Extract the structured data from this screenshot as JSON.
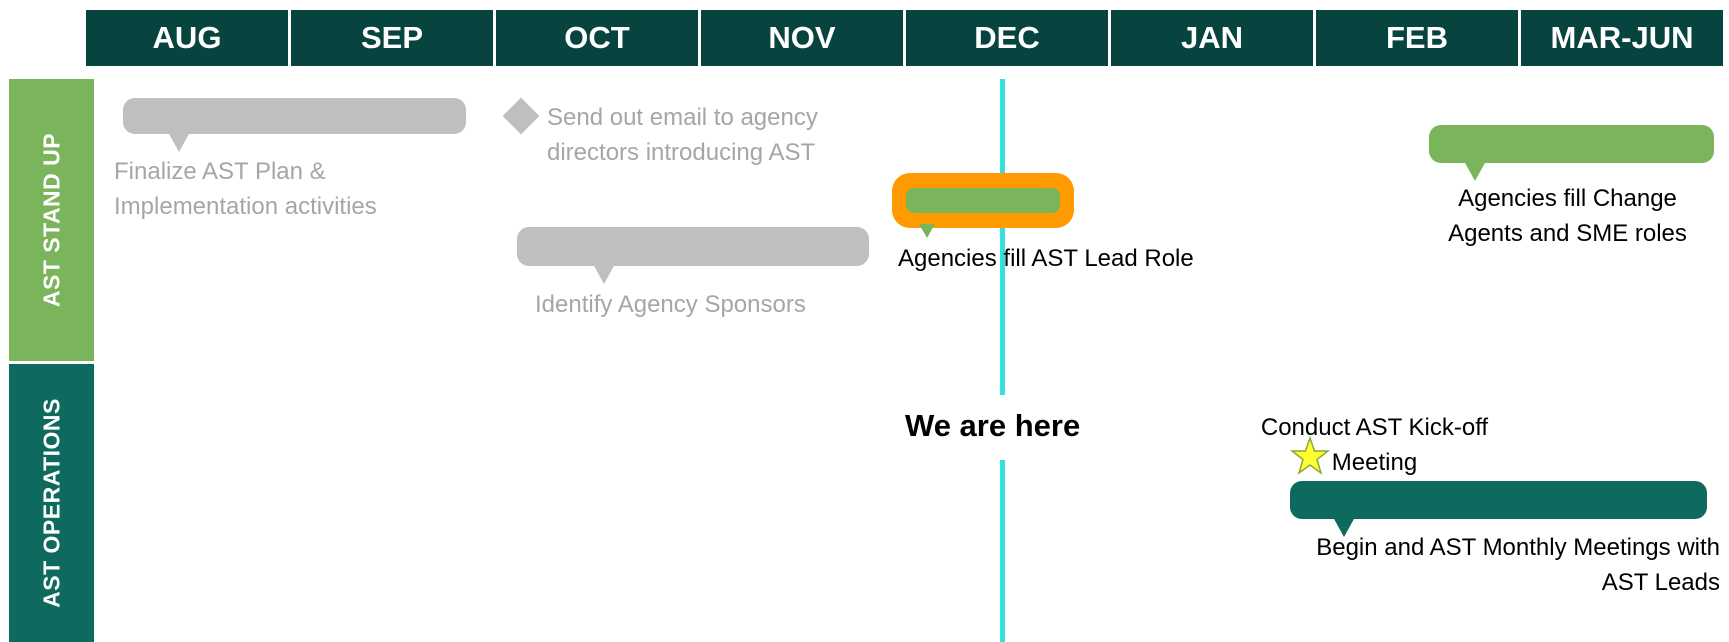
{
  "months": [
    "AUG",
    "SEP",
    "OCT",
    "NOV",
    "DEC",
    "JAN",
    "FEB",
    "MAR-JUN"
  ],
  "rows": {
    "stand_up": "AST STAND UP",
    "operations": "AST OPERATIONS"
  },
  "activities": {
    "finalize_plan": "Finalize AST Plan & Implementation activities",
    "send_email": "Send out email to agency directors introducing AST",
    "identify_sponsors": "Identify Agency Sponsors",
    "fill_lead_role": "Agencies fill AST Lead Role",
    "fill_change_agents": "Agencies fill Change Agents and SME roles",
    "kickoff_meeting": "Conduct AST Kick-off Meeting",
    "monthly_meetings": "Begin and AST Monthly Meetings with AST Leads"
  },
  "marker": {
    "label": "We are here"
  },
  "colors": {
    "header": "#08443f",
    "stand_up_row": "#7ab55c",
    "operations_row": "#0e6a5e",
    "grey_bar": "#bfbfbf",
    "green_bar": "#7ab55c",
    "teal_bar": "#0e6a5e",
    "highlight": "#ff9a00",
    "now_line": "#33e0de",
    "star": "#ffff33"
  }
}
